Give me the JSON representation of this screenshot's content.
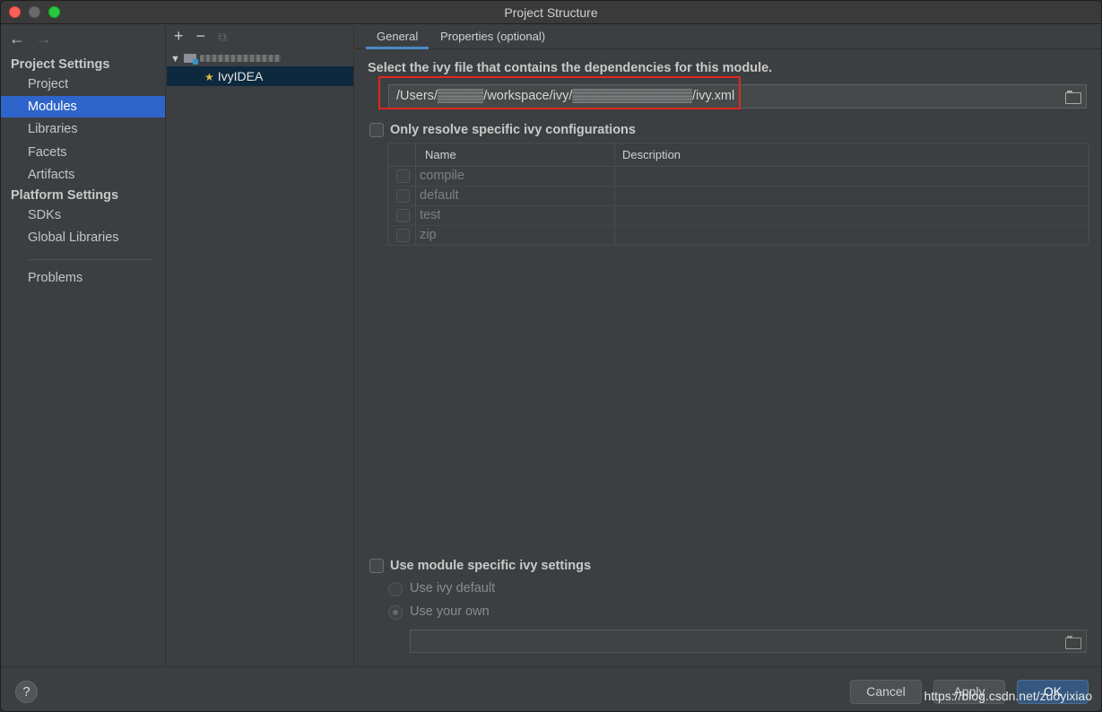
{
  "window": {
    "title": "Project Structure"
  },
  "sidebar": {
    "back_icon": "←",
    "forward_icon": "→",
    "project_settings_header": "Project Settings",
    "project_items": [
      {
        "label": "Project"
      },
      {
        "label": "Modules",
        "selected": true
      },
      {
        "label": "Libraries"
      },
      {
        "label": "Facets"
      },
      {
        "label": "Artifacts"
      }
    ],
    "platform_settings_header": "Platform Settings",
    "platform_items": [
      {
        "label": "SDKs"
      },
      {
        "label": "Global Libraries"
      }
    ],
    "problems_label": "Problems"
  },
  "tree": {
    "add_icon": "+",
    "remove_icon": "−",
    "copy_icon": "⧉",
    "expand_icon": "▼",
    "module_child_label": "IvyIDEA"
  },
  "tabs": [
    {
      "label": "General",
      "active": true
    },
    {
      "label": "Properties (optional)",
      "active": false
    }
  ],
  "general": {
    "ivy_file_prompt": "Select the ivy file that contains the dependencies for this module.",
    "ivy_file_path": "/Users/▒▒▒▒▒/workspace/ivy/▒▒▒▒▒▒▒▒▒▒▒▒▒/ivy.xml",
    "only_resolve_label": "Only resolve specific ivy configurations",
    "only_resolve_checked": false,
    "config_columns": {
      "name": "Name",
      "description": "Description"
    },
    "configurations": [
      {
        "name": "compile",
        "description": ""
      },
      {
        "name": "default",
        "description": ""
      },
      {
        "name": "test",
        "description": ""
      },
      {
        "name": "zip",
        "description": ""
      }
    ],
    "module_settings_label": "Use module specific ivy settings",
    "module_settings_checked": false,
    "use_ivy_default_label": "Use ivy default",
    "use_your_own_label": "Use your own",
    "settings_path_value": ""
  },
  "footer": {
    "help_label": "?",
    "cancel_label": "Cancel",
    "apply_label": "Apply",
    "ok_label": "OK",
    "watermark": "https://blog.csdn.net/zuoyixiao"
  },
  "colors": {
    "selection": "#2f65ca",
    "highlight_box": "#e0281d",
    "tab_underline": "#4a88c7"
  }
}
